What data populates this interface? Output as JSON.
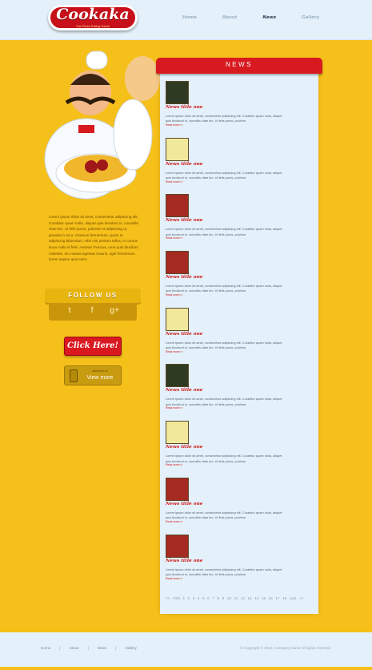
{
  "brand": {
    "logo_text": "Cookaka",
    "tagline": "The Pizza Eating Game"
  },
  "nav": {
    "items": [
      {
        "label": "Home"
      },
      {
        "label": "About"
      },
      {
        "label": "News"
      },
      {
        "label": "Gallery"
      }
    ],
    "active": "News"
  },
  "sidebar": {
    "description": "Lorem ipsum dolor sit amet, consectetur adipiscing elit. Curabitur quam nulla, aliquet quis tincidunt in, convallis vitae leo. Ut felis purus, pulvinar et adipiscing ut, gravida in arcu. Vivamus fermentum, quam et adipiscing bibendum, nibh nisi pretium tellus, in cursus lacus nulla id felis. Aenean rhoncus, urna quis faucibus molestie, leo massa egestas mauris, eget fermentum lorem sapien quis enim.",
    "follow_title": "FOLLOW US",
    "social": [
      {
        "name": "twitter-icon",
        "glyph": "t"
      },
      {
        "name": "facebook-icon",
        "glyph": "f"
      },
      {
        "name": "google-plus-icon",
        "glyph": "g+"
      }
    ],
    "click_label": "Click Here!",
    "view_small": "click here to",
    "view_label": "View more"
  },
  "news": {
    "title": "NEWS",
    "items": [
      {
        "title": "News title one",
        "text": "Lorem ipsum dolor sit amet, consectetur adipiscing elit. Curabitur quam nulla, aliquet quis tincidunt in, convallis vitae leo. Ut felis purus, pulvinar",
        "more": "Read more>>",
        "thumb": "t1"
      },
      {
        "title": "News title one",
        "text": "Lorem ipsum dolor sit amet, consectetur adipiscing elit. Curabitur quam nulla, aliquet quis tincidunt in, convallis vitae leo. Ut felis purus, pulvinar",
        "more": "Read more>>",
        "thumb": "t2"
      },
      {
        "title": "News title one",
        "text": "Lorem ipsum dolor sit amet, consectetur adipiscing elit. Curabitur quam nulla, aliquet quis tincidunt in, convallis vitae leo. Ut felis purus, pulvinar",
        "more": "Read more>>",
        "thumb": "t3"
      },
      {
        "title": "News title one",
        "text": "Lorem ipsum dolor sit amet, consectetur adipiscing elit. Curabitur quam nulla, aliquet quis tincidunt in, convallis vitae leo. Ut felis purus, pulvinar",
        "more": "Read more>>",
        "thumb": "t3"
      },
      {
        "title": "News title one",
        "text": "Lorem ipsum dolor sit amet, consectetur adipiscing elit. Curabitur quam nulla, aliquet quis tincidunt in, convallis vitae leo. Ut felis purus, pulvinar",
        "more": "Read more>>",
        "thumb": "t2"
      },
      {
        "title": "News title one",
        "text": "Lorem ipsum dolor sit amet, consectetur adipiscing elit. Curabitur quam nulla, aliquet quis tincidunt in, convallis vitae leo. Ut felis purus, pulvinar",
        "more": "Read more>>",
        "thumb": "t1"
      },
      {
        "title": "News title one",
        "text": "Lorem ipsum dolor sit amet, consectetur adipiscing elit. Curabitur quam nulla, aliquet quis tincidunt in, convallis vitae leo. Ut felis purus, pulvinar",
        "more": "Read more>>",
        "thumb": "t2"
      },
      {
        "title": "News title one",
        "text": "Lorem ipsum dolor sit amet, consectetur adipiscing elit. Curabitur quam nulla, aliquet quis tincidunt in, convallis vitae leo. Ut felis purus, pulvinar",
        "more": "Read more>>",
        "thumb": "t3"
      },
      {
        "title": "News title one",
        "text": "Lorem ipsum dolor sit amet, consectetur adipiscing elit. Curabitur quam nulla, aliquet quis tincidunt in, convallis vitae leo. Ut felis purus, pulvinar",
        "more": "Read more>>",
        "thumb": "t3"
      }
    ]
  },
  "pagination": [
    "<<",
    "First",
    "1",
    "2",
    "3",
    "4",
    "5",
    "6",
    "7",
    "8",
    "9",
    "10",
    "11",
    "12",
    "13",
    "14",
    "15",
    "16",
    "17",
    "18",
    "Last",
    ">>"
  ],
  "footer": {
    "links": [
      "Home",
      "About",
      "News",
      "Gallery"
    ],
    "copyright": "© Copyright © 2015. Company name All rights reserved"
  },
  "colors": {
    "background": "#f6c01b",
    "accent_red": "#d81a20",
    "panel": "#e4f1fb"
  }
}
